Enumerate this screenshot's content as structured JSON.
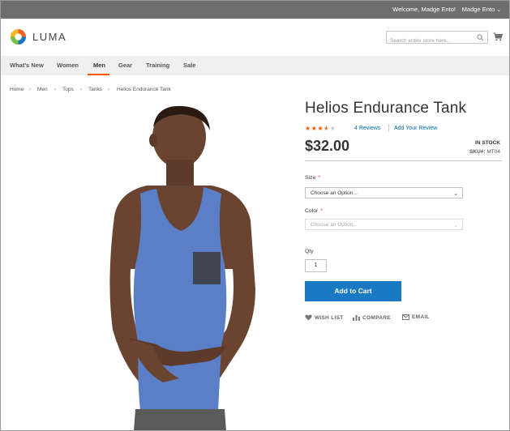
{
  "topbar": {
    "welcome": "Welcome, Madge Ento!",
    "account": "Madge Ento"
  },
  "header": {
    "logo_text": "LUMA",
    "search_placeholder": "Search entire store here...",
    "colors": {
      "brand_orange": "#ff5501",
      "link_blue": "#006bb4",
      "button_blue": "#1979c3"
    }
  },
  "nav": {
    "items": [
      "What's New",
      "Women",
      "Men",
      "Gear",
      "Training",
      "Sale"
    ],
    "active": "Men"
  },
  "breadcrumb": {
    "items": [
      "Home",
      "Men",
      "Tops",
      "Tanks",
      "Helios Endurance Tank"
    ]
  },
  "product": {
    "title": "Helios Endurance Tank",
    "rating_out_of_5": 3.5,
    "reviews_link": "4 Reviews",
    "add_review_link": "Add Your Review",
    "price": "$32.00",
    "stock": "IN STOCK",
    "sku_label": "SKU#:",
    "sku": "MT04",
    "size_label": "Size",
    "size_placeholder": "Choose an Option...",
    "color_label": "Color",
    "color_placeholder": "Choose an Option...",
    "required_mark": "*",
    "qty_label": "Qty",
    "qty_value": "1",
    "add_to_cart": "Add to Cart",
    "wishlist": "WISH LIST",
    "compare": "COMPARE",
    "email": "EMAIL"
  }
}
